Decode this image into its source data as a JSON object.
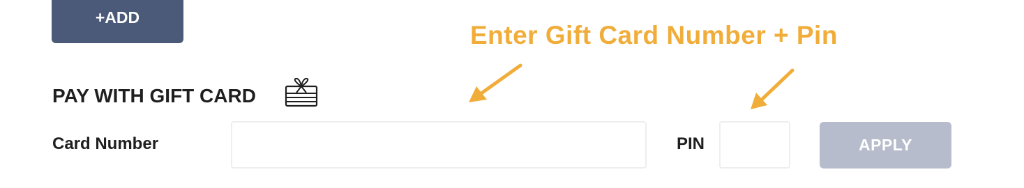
{
  "add_button": {
    "label": "+ADD"
  },
  "annotation": {
    "text": "Enter Gift Card Number + Pin",
    "color": "#f1ad3a"
  },
  "gift_card": {
    "title": "PAY WITH GIFT CARD",
    "icon": "gift-card-icon",
    "card_number": {
      "label": "Card Number",
      "value": "",
      "placeholder": ""
    },
    "pin": {
      "label": "PIN",
      "value": "",
      "placeholder": ""
    },
    "apply_button": {
      "label": "APPLY",
      "state": "disabled"
    }
  },
  "colors": {
    "add_button_bg": "#4b5a79",
    "apply_button_bg": "#b6bccb",
    "annotation": "#f1ad3a",
    "text": "#1f1f1f"
  }
}
